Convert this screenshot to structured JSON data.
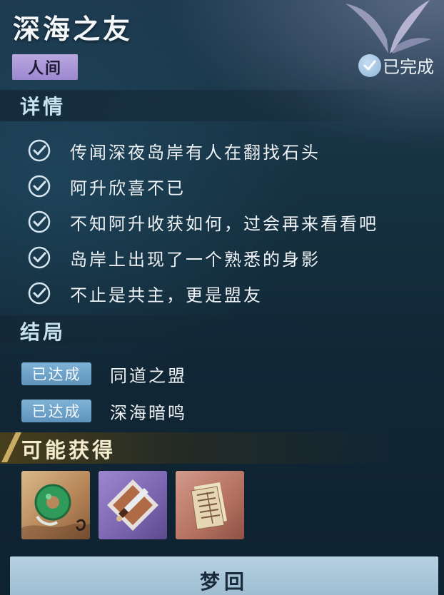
{
  "quest": {
    "title": "深海之友",
    "world_tag": "人间",
    "status": "已完成"
  },
  "details": {
    "heading": "详情",
    "tasks": [
      {
        "text": "传闻深夜岛岸有人在翻找石头",
        "done": true
      },
      {
        "text": "阿升欣喜不已",
        "done": true
      },
      {
        "text": "不知阿升收获如何，过会再来看看吧",
        "done": true
      },
      {
        "text": "岛岸上出现了一个熟悉的身影",
        "done": true
      },
      {
        "text": "不止是共主，更是盟友",
        "done": true
      }
    ]
  },
  "endings": {
    "heading": "结局",
    "items": [
      {
        "badge": "已达成",
        "text": "同道之盟"
      },
      {
        "badge": "已达成",
        "text": "深海暗鸣"
      }
    ]
  },
  "rewards": {
    "heading": "可能获得",
    "items": [
      {
        "icon": "jade-pendant-icon",
        "rarity_color": "#c99a66"
      },
      {
        "icon": "dagger-icon",
        "rarity_color": "#8a74c2"
      },
      {
        "icon": "scroll-document-icon",
        "rarity_color": "#c0806e"
      }
    ]
  },
  "action": {
    "dream_label": "梦回"
  },
  "colors": {
    "background": "#15303f",
    "world_tag": "#a895d6",
    "ending_badge": "#6fa3c9",
    "button": "#a9c6da"
  }
}
